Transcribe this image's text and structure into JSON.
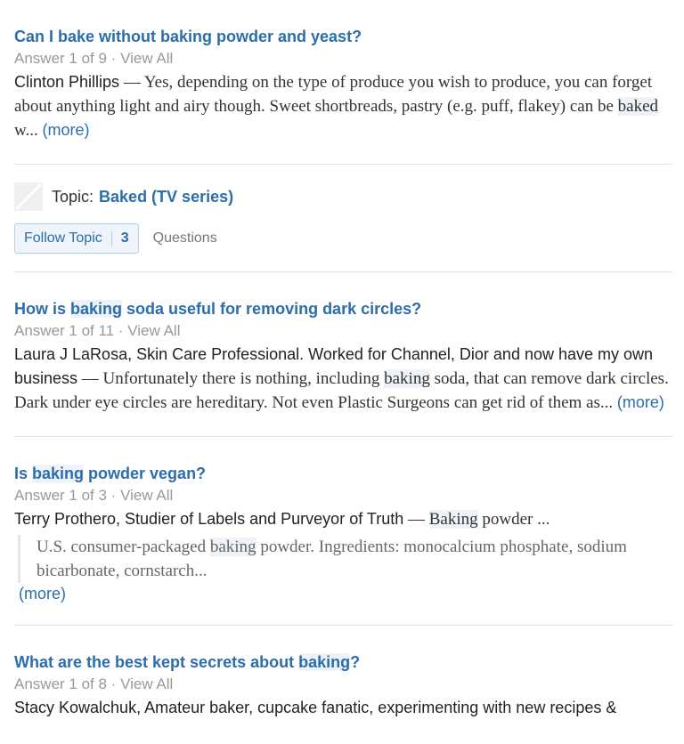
{
  "results": [
    {
      "title": "Can I bake without baking powder and yeast?",
      "answer_meta": "Answer 1 of 9",
      "view_all": "View All",
      "author": "Clinton Phillips",
      "dash": " — ",
      "text_a": "Yes, depending on the type of produce you wish to produce, you can forget about anything light and airy though. Sweet shortbreads, pastry (e.g. puff, flakey) can be ",
      "hl": "baked",
      "text_b": " w... ",
      "more": "(more)"
    },
    {
      "title_a": "How is ",
      "title_hl": "baking",
      "title_b": " soda useful for removing dark circles?",
      "answer_meta": "Answer 1 of 11",
      "view_all": "View All",
      "author": "Laura J LaRosa, Skin Care Professional. Worked for Channel, Dior and now have my own business",
      "dash": " — ",
      "text_a": "Unfortunately there is nothing, including ",
      "hl": "baking",
      "text_b": " soda, that can remove dark circles. Dark under eye circles are hereditary. Not even Plastic Surgeons can get rid of them as... ",
      "more": "(more)"
    },
    {
      "title_a": "Is ",
      "title_hl": "baking",
      "title_b": " powder vegan?",
      "answer_meta": "Answer 1 of 3",
      "view_all": "View All",
      "author": "Terry Prothero, Studier of Labels and Purveyor of Truth",
      "dash": " — ",
      "hl": "Baking",
      "text_b": " powder ...",
      "quote_a": "U.S. consumer-packaged ",
      "quote_hl": "baking",
      "quote_b": " powder. Ingredients: monocalcium phosphate, sodium bicarbonate, cornstarch...",
      "more": "(more)"
    },
    {
      "title_a": "What are the best kept secrets about ",
      "title_hl": "baking",
      "title_b": "?",
      "answer_meta": "Answer 1 of 8",
      "view_all": "View All",
      "author": "Stacy Kowalchuk, Amateur baker, cupcake fanatic, experimenting with new recipes &"
    }
  ],
  "topic": {
    "label": "Topic:",
    "name": "Baked (TV series)",
    "follow_label": "Follow Topic",
    "follow_count": "3",
    "questions_label": "Questions",
    "image_icon": "topic-placeholder-icon"
  },
  "separator": " · ",
  "colors": {
    "link": "#2b6dad",
    "muted": "#999999",
    "highlight": "#eef3f9"
  }
}
